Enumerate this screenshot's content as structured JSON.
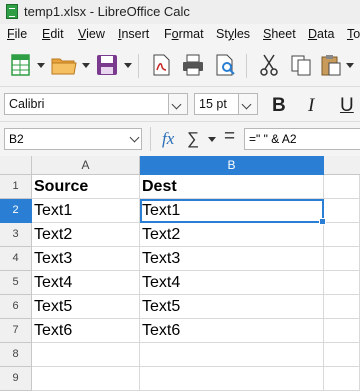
{
  "window": {
    "title": "temp1.xlsx - LibreOffice Calc"
  },
  "menu": [
    {
      "label": "File",
      "accel": "F",
      "rest": "ile"
    },
    {
      "label": "Edit",
      "accel": "E",
      "rest": "dit"
    },
    {
      "label": "View",
      "accel": "V",
      "rest": "iew"
    },
    {
      "label": "Insert",
      "accel": "I",
      "rest": "nsert"
    },
    {
      "label": "Format",
      "accel": "o",
      "pre": "F",
      "rest": "rmat"
    },
    {
      "label": "Styles",
      "accel": "y",
      "pre": "St",
      "rest": "les"
    },
    {
      "label": "Sheet",
      "accel": "S",
      "rest": "heet"
    },
    {
      "label": "Data",
      "accel": "D",
      "rest": "ata"
    },
    {
      "label": "Tools",
      "accel": "T",
      "rest": "o"
    }
  ],
  "formatting": {
    "font_name": "Calibri",
    "font_size": "15 pt",
    "bold_label": "B",
    "italic_label": "I",
    "underline_label": "U"
  },
  "formula_bar": {
    "name_box": "B2",
    "formula": "=\" \" & A2",
    "fx": "fx",
    "sigma": "∑",
    "equals": "="
  },
  "columns": [
    "A",
    "B"
  ],
  "selected_column": "B",
  "rows": [
    {
      "num": "1",
      "a": "Source",
      "b": "Dest",
      "bold": true
    },
    {
      "num": "2",
      "a": "Text1",
      "b": "Text1",
      "selected": true
    },
    {
      "num": "3",
      "a": "Text2",
      "b": "Text2"
    },
    {
      "num": "4",
      "a": "Text3",
      "b": "Text3"
    },
    {
      "num": "5",
      "a": "Text4",
      "b": "Text4"
    },
    {
      "num": "6",
      "a": "Text5",
      "b": "Text5"
    },
    {
      "num": "7",
      "a": "Text6",
      "b": "Text6"
    },
    {
      "num": "8",
      "a": "",
      "b": ""
    },
    {
      "num": "9",
      "a": "",
      "b": ""
    }
  ],
  "colors": {
    "selection": "#2a7fd4",
    "calc_green": "#2f9e44"
  },
  "icons": [
    "new-spreadsheet-icon",
    "open-folder-icon",
    "save-icon",
    "export-pdf-icon",
    "print-icon",
    "print-preview-icon",
    "cut-icon",
    "copy-icon",
    "paste-icon"
  ]
}
